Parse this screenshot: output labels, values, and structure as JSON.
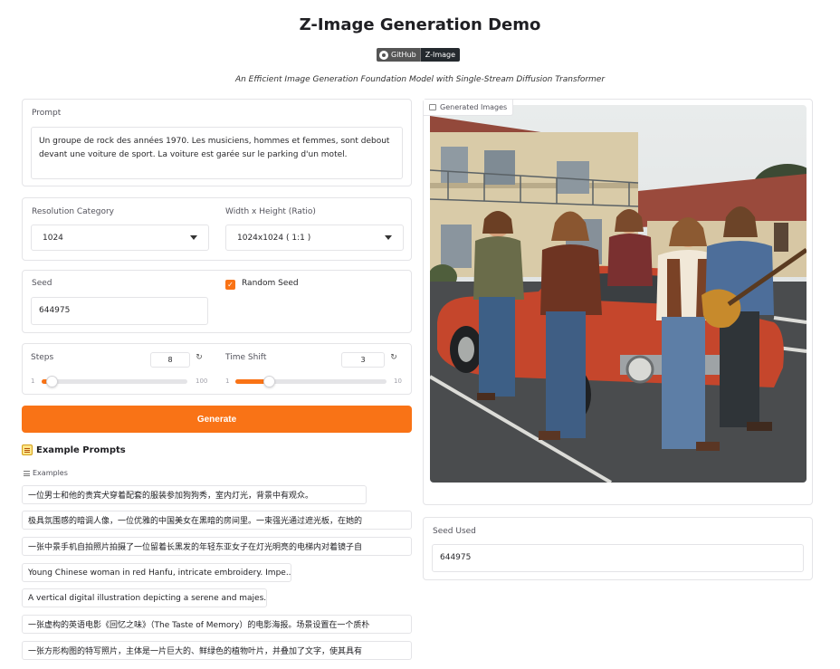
{
  "header": {
    "title": "Z-Image Generation Demo",
    "badge_left": "GitHub",
    "badge_right": "Z-Image",
    "subtitle": "An Efficient Image Generation Foundation Model with Single-Stream Diffusion Transformer"
  },
  "prompt": {
    "label": "Prompt",
    "value": "Un groupe de rock des années 1970. Les musiciens, hommes et femmes, sont debout devant une voiture de sport. La voiture est garée sur le parking d'un motel."
  },
  "resolution": {
    "category_label": "Resolution Category",
    "category_value": "1024",
    "size_label": "Width x Height (Ratio)",
    "size_value": "1024x1024 ( 1:1 )"
  },
  "seed": {
    "label": "Seed",
    "value": "644975",
    "random_label": "Random Seed",
    "random_checked": true
  },
  "steps": {
    "label": "Steps",
    "value": "8",
    "min": "1",
    "max": "100",
    "fraction": 0.07
  },
  "time_shift": {
    "label": "Time Shift",
    "value": "3",
    "min": "1",
    "max": "10",
    "fraction": 0.22
  },
  "generate_label": "Generate",
  "examples": {
    "heading": "Example Prompts",
    "sub_label": "Examples",
    "items": [
      "一位男士和他的贵宾犬穿着配套的服装参加狗狗秀，室内灯光，背景中有观众。",
      "极具氛围感的暗调人像，一位优雅的中国美女在黑暗的房间里。一束强光通过遮光板，在她的",
      "一张中景手机自拍照片拍摄了一位留着长黑发的年轻东亚女子在灯光明亮的电梯内对着镜子自",
      "Young Chinese woman in red Hanfu, intricate embroidery. Impe...",
      "A vertical digital illustration depicting a serene and majes...",
      "一张虚构的英语电影《回忆之味》（The Taste of Memory）的电影海报。场景设置在一个质朴",
      "一张方形构图的特写照片，主体是一片巨大的、鲜绿色的植物叶片，并叠加了文字，使其具有"
    ]
  },
  "output": {
    "images_label": "Generated Images",
    "seed_used_label": "Seed Used",
    "seed_used_value": "644975"
  }
}
